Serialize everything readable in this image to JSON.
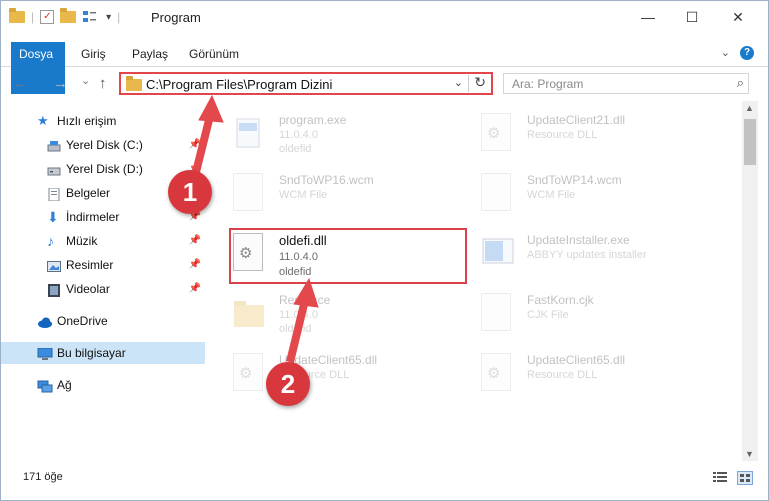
{
  "window": {
    "title": "Program",
    "minimize": "—",
    "maximize": "☐",
    "close": "✕"
  },
  "ribbon": {
    "tabs": [
      "Dosya",
      "Giriş",
      "Paylaş",
      "Görünüm"
    ],
    "help": "?"
  },
  "nav": {
    "back": "←",
    "forward": "→",
    "recent": "⌄",
    "up": "↑",
    "address": "C:\\Program Files\\Program Dizini",
    "search_placeholder": "Ara: Program"
  },
  "sidebar": {
    "items": [
      {
        "label": "Hızlı erişim",
        "icon": "star-icon"
      },
      {
        "label": "Yerel Disk (C:)",
        "icon": "drive-icon",
        "pinned": true
      },
      {
        "label": "Yerel Disk (D:)",
        "icon": "drive-icon",
        "pinned": true
      },
      {
        "label": "Belgeler",
        "icon": "documents-icon",
        "pinned": true
      },
      {
        "label": "İndirmeler",
        "icon": "download-icon",
        "pinned": true
      },
      {
        "label": "Müzik",
        "icon": "music-icon",
        "pinned": true
      },
      {
        "label": "Resimler",
        "icon": "pictures-icon",
        "pinned": true
      },
      {
        "label": "Videolar",
        "icon": "video-icon",
        "pinned": true
      },
      {
        "label": "OneDrive",
        "icon": "cloud-icon"
      },
      {
        "label": "Bu bilgisayar",
        "icon": "computer-icon",
        "selected": true
      },
      {
        "label": "Ağ",
        "icon": "network-icon"
      }
    ]
  },
  "files": [
    {
      "name": "program.exe",
      "l2": "11.0.4.0",
      "l3": "oldefid"
    },
    {
      "name": "UpdateClient21.dll",
      "l2": "Resource DLL",
      "l3": ""
    },
    {
      "name": "SndToWP16.wcm",
      "l2": "WCM File",
      "l3": ""
    },
    {
      "name": "SndToWP14.wcm",
      "l2": "WCM File",
      "l3": ""
    },
    {
      "name": "oldefi.dll",
      "l2": "11.0.4.0",
      "l3": "oldefid"
    },
    {
      "name": "UpdateInstaller.exe",
      "l2": "ABBYY updates installer",
      "l3": ""
    },
    {
      "name": "Resource",
      "l2": "11.0.4.0",
      "l3": "oldefid"
    },
    {
      "name": "FastKorn.cjk",
      "l2": "CJK File",
      "l3": ""
    },
    {
      "name": "UpdateClient65.dll",
      "l2": "Resource DLL",
      "l3": ""
    },
    {
      "name": "UpdateClient65.dll",
      "l2": "Resource DLL",
      "l3": ""
    }
  ],
  "status": {
    "count": "171 öğe"
  },
  "callouts": {
    "one": "1",
    "two": "2"
  }
}
